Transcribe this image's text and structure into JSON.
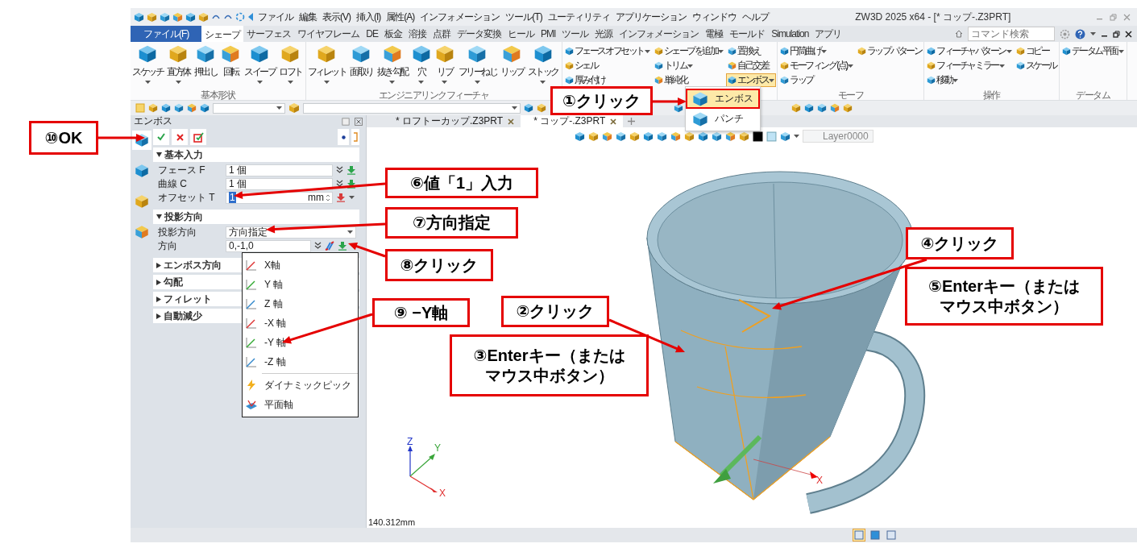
{
  "title_bar": {
    "menu": [
      "ファイル",
      "編集",
      "表示(V)",
      "挿入(I)",
      "属性(A)",
      "インフォメーション",
      "ツール(T)",
      "ユーティリティ",
      "アプリケーション",
      "ウィンドウ",
      "ヘルプ"
    ],
    "title": "ZW3D 2025 x64 - [* コップ-.Z3PRT]"
  },
  "ribbon_tabs": [
    {
      "label": "ファイル(F)",
      "kind": "file",
      "selected": false
    },
    {
      "label": "シェープ",
      "kind": "tab",
      "selected": true
    },
    {
      "label": "サーフェス",
      "kind": "tab",
      "selected": false
    },
    {
      "label": "ワイヤフレーム",
      "kind": "tab",
      "selected": false
    },
    {
      "label": "DE",
      "kind": "tab",
      "selected": false
    },
    {
      "label": "板金",
      "kind": "tab",
      "selected": false
    },
    {
      "label": "溶接",
      "kind": "tab",
      "selected": false
    },
    {
      "label": "点群",
      "kind": "tab",
      "selected": false
    },
    {
      "label": "データ変換",
      "kind": "tab",
      "selected": false
    },
    {
      "label": "ヒール",
      "kind": "tab",
      "selected": false
    },
    {
      "label": "PMI",
      "kind": "tab",
      "selected": false
    },
    {
      "label": "ツール",
      "kind": "tab",
      "selected": false
    },
    {
      "label": "光源",
      "kind": "tab",
      "selected": false
    },
    {
      "label": "インフォメーション",
      "kind": "tab",
      "selected": false
    },
    {
      "label": "電極",
      "kind": "tab",
      "selected": false
    },
    {
      "label": "モールド",
      "kind": "tab",
      "selected": false
    },
    {
      "label": "Simulation",
      "kind": "tab",
      "selected": false
    },
    {
      "label": "アプリ",
      "kind": "tab",
      "selected": false
    }
  ],
  "command_search": {
    "placeholder": "コマンド検索"
  },
  "ribbon_groups": [
    {
      "title": "基本形状",
      "items": [
        {
          "kind": "large",
          "label": "スケッチ",
          "dropdown": true
        },
        {
          "kind": "large",
          "label": "直方体",
          "dropdown": true
        },
        {
          "kind": "large",
          "label": "押出し",
          "dropdown": false
        },
        {
          "kind": "large",
          "label": "回転",
          "dropdown": false
        },
        {
          "kind": "large",
          "label": "スイープ",
          "dropdown": true
        },
        {
          "kind": "large",
          "label": "ロフト",
          "dropdown": true
        }
      ]
    },
    {
      "title": "エンジニアリンクフィーチャ",
      "items": [
        {
          "kind": "large",
          "label": "フィレット",
          "dropdown": true
        },
        {
          "kind": "large",
          "label": "面取り",
          "dropdown": false
        },
        {
          "kind": "large",
          "label": "抜き勾配",
          "dropdown": true
        },
        {
          "kind": "large",
          "label": "穴",
          "dropdown": true
        },
        {
          "kind": "large",
          "label": "リブ",
          "dropdown": true
        },
        {
          "kind": "large",
          "label": "フリーねじ",
          "dropdown": true
        },
        {
          "kind": "large",
          "label": "リップ",
          "dropdown": false
        },
        {
          "kind": "large",
          "label": "ストック",
          "dropdown": true
        }
      ]
    },
    {
      "items": [
        {
          "kind": "column",
          "buttons": [
            {
              "label": "フェース オフセット",
              "dropdown": true,
              "highlighted": false
            },
            {
              "label": "シェル",
              "dropdown": false,
              "highlighted": false
            },
            {
              "label": "厚み付け",
              "dropdown": false,
              "highlighted": false
            }
          ]
        },
        {
          "kind": "column",
          "buttons": [
            {
              "label": "シェープを追加",
              "dropdown": true,
              "highlighted": false
            },
            {
              "label": "トリム",
              "dropdown": true,
              "highlighted": false
            },
            {
              "label": "単純化",
              "dropdown": false,
              "highlighted": false
            }
          ]
        },
        {
          "kind": "column",
          "buttons": [
            {
              "label": "置換え",
              "dropdown": false,
              "highlighted": false
            },
            {
              "label": "自己交差",
              "dropdown": false,
              "highlighted": false
            },
            {
              "label": "エンボス",
              "dropdown": true,
              "highlighted": true
            }
          ]
        }
      ]
    },
    {
      "title": "モーフ",
      "items": [
        {
          "kind": "column",
          "buttons": [
            {
              "label": "円筒曲げ",
              "dropdown": true,
              "highlighted": false
            },
            {
              "label": "モーフィング (点)",
              "dropdown": true,
              "highlighted": false
            },
            {
              "label": "ラップ",
              "dropdown": false,
              "highlighted": false
            }
          ]
        },
        {
          "kind": "column",
          "buttons": [
            {
              "label": "ラップ パターン",
              "dropdown": false,
              "highlighted": false
            }
          ]
        }
      ]
    },
    {
      "title": "操作",
      "items": [
        {
          "kind": "column",
          "buttons": [
            {
              "label": "フィーチャパターン",
              "dropdown": true,
              "highlighted": false
            },
            {
              "label": "フィーチャ ミラー",
              "dropdown": true,
              "highlighted": false
            },
            {
              "label": "移動",
              "dropdown": true,
              "highlighted": false
            }
          ]
        },
        {
          "kind": "column",
          "buttons": [
            {
              "label": "コピー",
              "dropdown": false,
              "highlighted": false
            },
            {
              "label": "スケール",
              "dropdown": false,
              "highlighted": false
            }
          ]
        }
      ]
    },
    {
      "title": "データム",
      "items": [
        {
          "kind": "column",
          "buttons": [
            {
              "label": "データム平面",
              "dropdown": true,
              "highlighted": false
            }
          ]
        }
      ]
    }
  ],
  "emboss_menu": [
    {
      "label": "エンボス",
      "selected": true
    },
    {
      "label": "パンチ",
      "selected": false
    }
  ],
  "panel": {
    "title": "エンボス",
    "sections": [
      {
        "title": "基本入力",
        "expanded": true,
        "rows": [
          {
            "label": "フェース F",
            "kind": "pick",
            "value": "1 個"
          },
          {
            "label": "曲線 C",
            "kind": "pick",
            "value": "1 個"
          },
          {
            "label": "オフセット T",
            "kind": "number",
            "value": "1",
            "unit": "mm"
          }
        ]
      },
      {
        "title": "投影方向",
        "expanded": true,
        "rows": [
          {
            "label": "投影方向",
            "kind": "select",
            "value": "方向指定"
          },
          {
            "label": "方向",
            "kind": "vector",
            "value": "0,-1,0"
          }
        ]
      },
      {
        "title": "エンボス方向",
        "expanded": false
      },
      {
        "title": "勾配",
        "expanded": false
      },
      {
        "title": "フィレット",
        "expanded": false
      },
      {
        "title": "自動減少",
        "expanded": false
      }
    ]
  },
  "direction_menu": [
    {
      "label": "X軸",
      "kind": "axis"
    },
    {
      "label": "Y 軸",
      "kind": "axis"
    },
    {
      "label": "Z 軸",
      "kind": "axis"
    },
    {
      "label": "-X 軸",
      "kind": "axis"
    },
    {
      "label": "-Y 軸",
      "kind": "axis"
    },
    {
      "label": "-Z 軸",
      "kind": "axis"
    },
    {
      "label": "ダイナミックピック",
      "kind": "pick"
    },
    {
      "label": "平面軸",
      "kind": "plane"
    }
  ],
  "documents": [
    {
      "title": "* ロフトーカップ.Z3PRT",
      "selected": false
    },
    {
      "title": "* コップ-.Z3PRT",
      "selected": true
    }
  ],
  "view_toolbar": {
    "layer": "Layer0000"
  },
  "viewport": {
    "triad_labels": [
      "Z",
      "Y",
      "X"
    ],
    "model_axis_label": "X",
    "scale_text": "140.312mm"
  },
  "status_bar": [
    {
      "selected": true
    },
    {
      "selected": false
    },
    {
      "selected": false
    }
  ],
  "annotations": [
    {
      "text": "①クリック"
    },
    {
      "text": "⑩OK"
    },
    {
      "text": "⑥値「1」入力"
    },
    {
      "text": "⑦方向指定"
    },
    {
      "text": "④クリック"
    },
    {
      "text": "⑧クリック"
    },
    {
      "text": "⑨ −Y軸"
    },
    {
      "text": "②クリック"
    },
    {
      "text": "⑤Enterキー（またはマウス中ボタン）"
    },
    {
      "text": "③Enterキー（またはマウス中ボタン）"
    }
  ]
}
